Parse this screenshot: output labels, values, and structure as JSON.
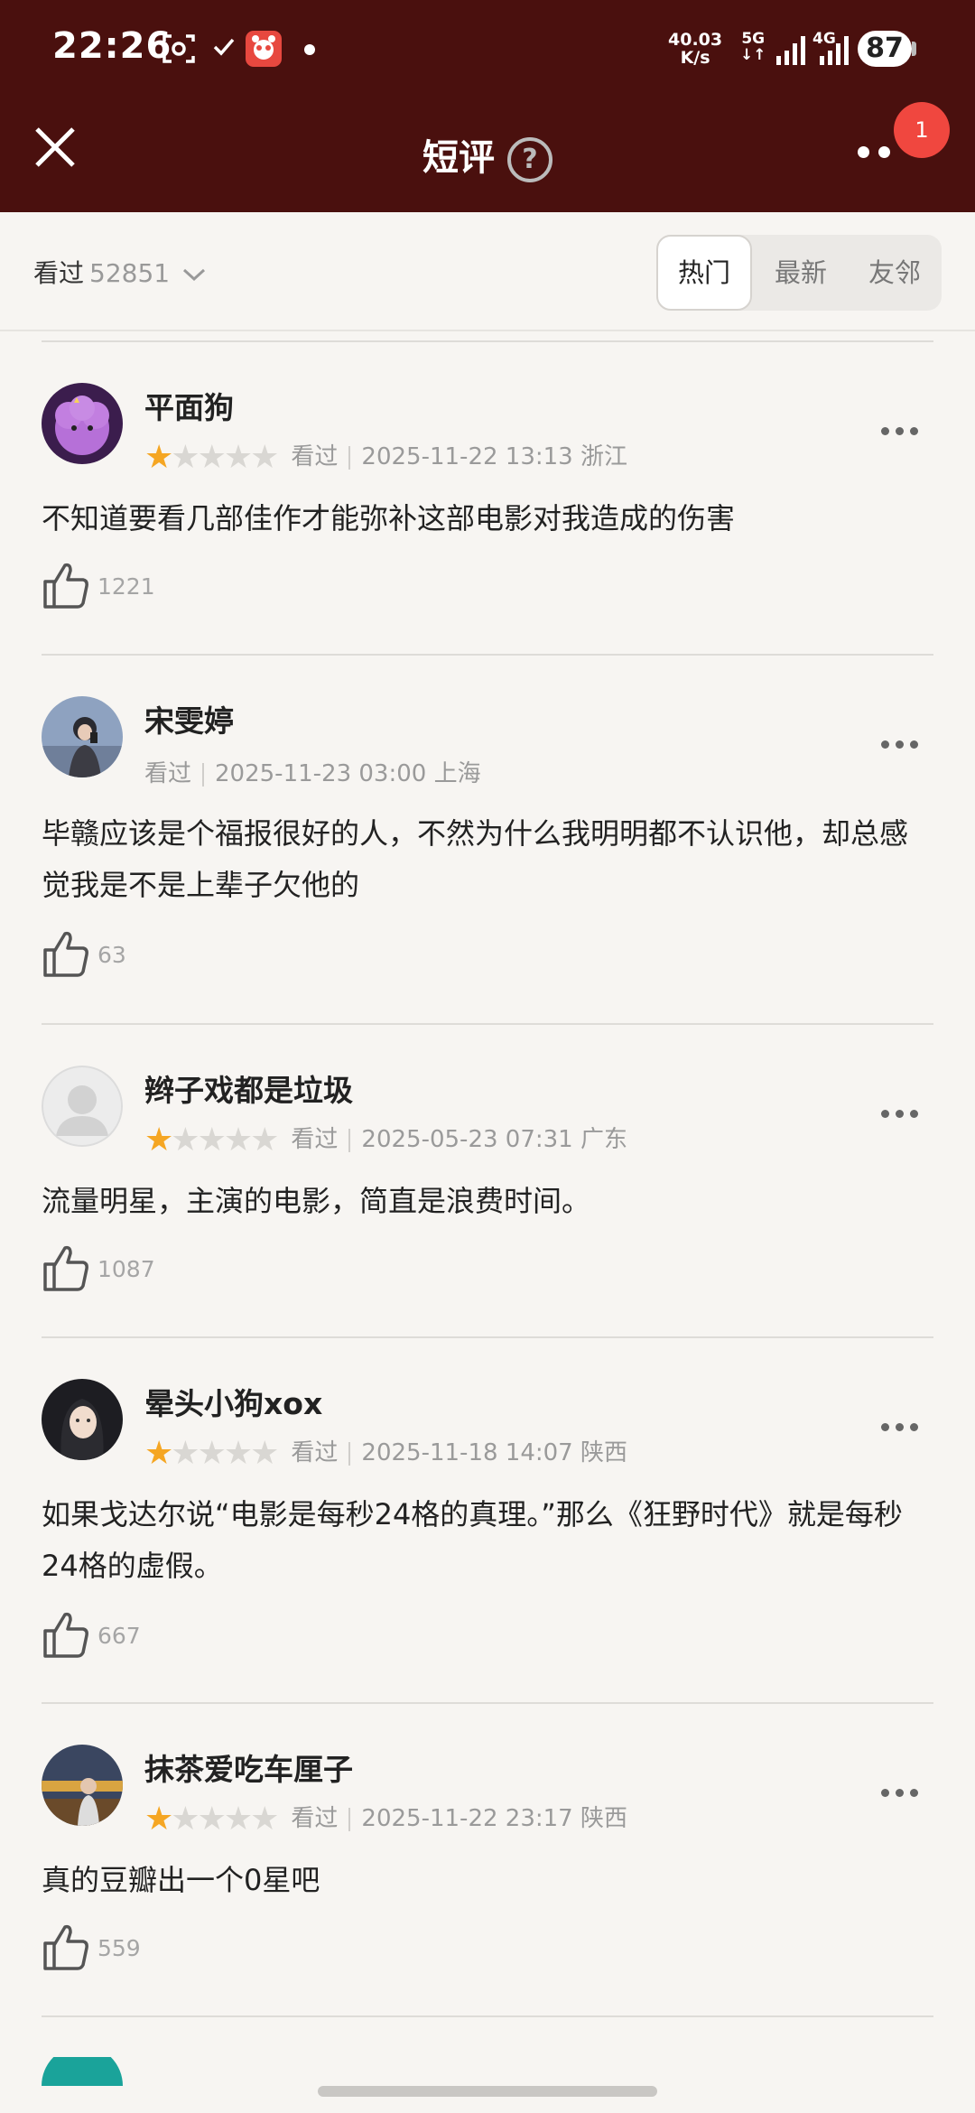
{
  "status_bar": {
    "time": "22:26",
    "net_speed_value": "40.03",
    "net_speed_unit": "K/s",
    "gen1": "5G",
    "gen2": "4G",
    "battery": "87",
    "icons": [
      "screenshot-icon",
      "check-icon",
      "app-notification-icon",
      "dot-icon",
      "signal-icon"
    ]
  },
  "nav": {
    "title": "短评",
    "help": "?",
    "notification_count": "1"
  },
  "filter": {
    "seen_label": "看过",
    "seen_count": "52851",
    "tabs": [
      "热门",
      "最新",
      "友邻"
    ],
    "active_tab": "热门"
  },
  "reviews": [
    {
      "user": "平面狗",
      "rating": 1,
      "status": "看过",
      "time": "2025-11-22 13:13",
      "location": "浙江",
      "text": "不知道要看几部佳作才能弥补这部电影对我造成的伤害",
      "likes": "1221"
    },
    {
      "user": "宋雯婷",
      "rating": 0,
      "status": "看过",
      "time": "2025-11-23 03:00",
      "location": "上海",
      "text": "毕赣应该是个福报很好的人，不然为什么我明明都不认识他，却总感觉我是不是上辈子欠他的",
      "likes": "63"
    },
    {
      "user": "辫子戏都是垃圾",
      "rating": 1,
      "status": "看过",
      "time": "2025-05-23 07:31",
      "location": "广东",
      "text": "流量明星，主演的电影，简直是浪费时间。",
      "likes": "1087"
    },
    {
      "user": "晕头小狗xox",
      "rating": 1,
      "status": "看过",
      "time": "2025-11-18 14:07",
      "location": "陕西",
      "text": "如果戈达尔说“电影是每秒24格的真理。”那么《狂野时代》就是每秒24格的虚假。",
      "likes": "667"
    },
    {
      "user": "抹茶爱吃车厘子",
      "rating": 1,
      "status": "看过",
      "time": "2025-11-22 23:17",
      "location": "陕西",
      "text": "真的豆瓣出一个0星吧",
      "likes": "559"
    }
  ],
  "colors": {
    "header": "#4a100e",
    "star": "#f5a623",
    "badge": "#f0473f",
    "background": "#f7f5f2"
  }
}
